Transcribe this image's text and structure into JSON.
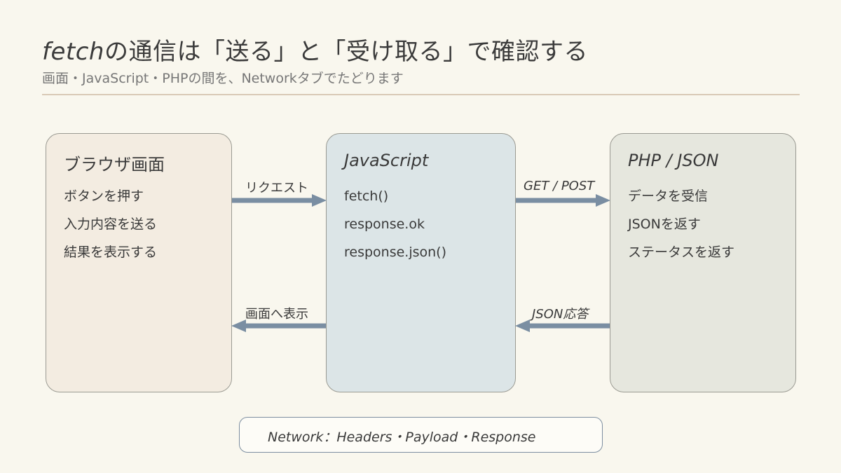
{
  "header": {
    "title_em": "fetch",
    "title_rest": "の通信は「送る」と「受け取る」で確認する",
    "subtitle": "画面・JavaScript・PHPの間を、Networkタブでたどります"
  },
  "boxes": {
    "browser": {
      "title": "ブラウザ画面",
      "items": [
        "ボタンを押す",
        "入力内容を送る",
        "結果を表示する"
      ]
    },
    "js": {
      "title": "JavaScript",
      "items": [
        "fetch()",
        "response.ok",
        "response.json()"
      ]
    },
    "php": {
      "title": "PHP / JSON",
      "items": [
        "データを受信",
        "JSONを返す",
        "ステータスを返す"
      ]
    }
  },
  "arrows": {
    "request": "リクエスト",
    "get_post": "GET / POST",
    "display": "画面へ表示",
    "json_response": "JSON応答"
  },
  "footer": {
    "text": "Network：Headers・Payload・Response"
  },
  "colors": {
    "arrow": "#7a8ea2",
    "rule": "#d9c9b6",
    "background": "#f9f7ee"
  }
}
